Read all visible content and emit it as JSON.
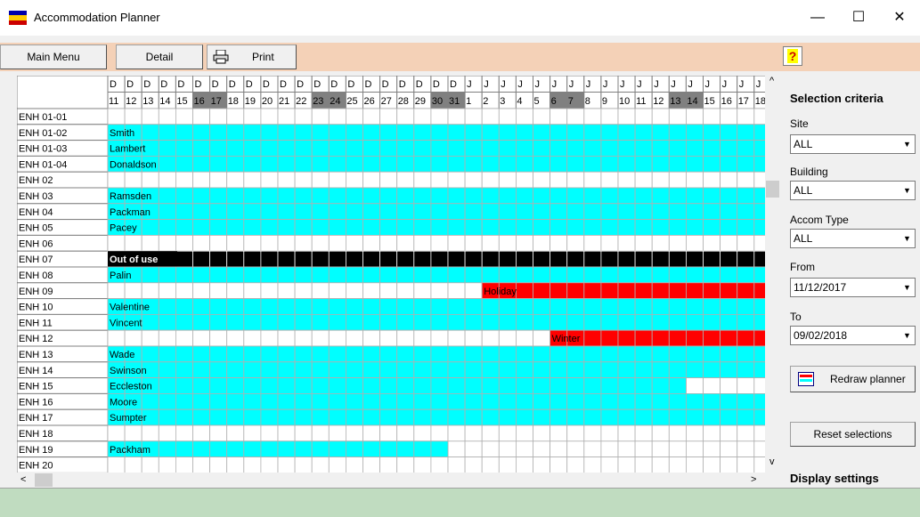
{
  "window": {
    "title": "Accommodation Planner",
    "min_glyph": "—",
    "max_glyph": "☐",
    "close_glyph": "✕"
  },
  "toolbar": {
    "main_menu": "Main Menu",
    "detail": "Detail",
    "print": "Print",
    "print_icon": "printer-icon",
    "help_icon": "help-icon",
    "help_glyph": "?"
  },
  "grid": {
    "date_header": [
      {
        "m": "D",
        "d": "11",
        "w": false
      },
      {
        "m": "D",
        "d": "12",
        "w": false
      },
      {
        "m": "D",
        "d": "13",
        "w": false
      },
      {
        "m": "D",
        "d": "14",
        "w": false
      },
      {
        "m": "D",
        "d": "15",
        "w": false
      },
      {
        "m": "D",
        "d": "16",
        "w": true
      },
      {
        "m": "D",
        "d": "17",
        "w": true
      },
      {
        "m": "D",
        "d": "18",
        "w": false
      },
      {
        "m": "D",
        "d": "19",
        "w": false
      },
      {
        "m": "D",
        "d": "20",
        "w": false
      },
      {
        "m": "D",
        "d": "21",
        "w": false
      },
      {
        "m": "D",
        "d": "22",
        "w": false
      },
      {
        "m": "D",
        "d": "23",
        "w": true
      },
      {
        "m": "D",
        "d": "24",
        "w": true
      },
      {
        "m": "D",
        "d": "25",
        "w": false
      },
      {
        "m": "D",
        "d": "26",
        "w": false
      },
      {
        "m": "D",
        "d": "27",
        "w": false
      },
      {
        "m": "D",
        "d": "28",
        "w": false
      },
      {
        "m": "D",
        "d": "29",
        "w": false
      },
      {
        "m": "D",
        "d": "30",
        "w": true
      },
      {
        "m": "D",
        "d": "31",
        "w": true
      },
      {
        "m": "J",
        "d": "1",
        "w": false
      },
      {
        "m": "J",
        "d": "2",
        "w": false
      },
      {
        "m": "J",
        "d": "3",
        "w": false
      },
      {
        "m": "J",
        "d": "4",
        "w": false
      },
      {
        "m": "J",
        "d": "5",
        "w": false
      },
      {
        "m": "J",
        "d": "6",
        "w": true
      },
      {
        "m": "J",
        "d": "7",
        "w": true
      },
      {
        "m": "J",
        "d": "8",
        "w": false
      },
      {
        "m": "J",
        "d": "9",
        "w": false
      },
      {
        "m": "J",
        "d": "10",
        "w": false
      },
      {
        "m": "J",
        "d": "11",
        "w": false
      },
      {
        "m": "J",
        "d": "12",
        "w": false
      },
      {
        "m": "J",
        "d": "13",
        "w": true
      },
      {
        "m": "J",
        "d": "14",
        "w": true
      },
      {
        "m": "J",
        "d": "15",
        "w": false
      },
      {
        "m": "J",
        "d": "16",
        "w": false
      },
      {
        "m": "J",
        "d": "17",
        "w": false
      },
      {
        "m": "J",
        "d": "18",
        "w": false
      }
    ],
    "rows": [
      {
        "room": "ENH 01-01",
        "bookings": []
      },
      {
        "room": "ENH 01-02",
        "bookings": [
          {
            "label": "Smith",
            "start": 0,
            "end": 39,
            "kind": "guest"
          }
        ]
      },
      {
        "room": "ENH 01-03",
        "bookings": [
          {
            "label": "Lambert",
            "start": 0,
            "end": 39,
            "kind": "guest"
          }
        ]
      },
      {
        "room": "ENH 01-04",
        "bookings": [
          {
            "label": "Donaldson",
            "start": 0,
            "end": 39,
            "kind": "guest"
          }
        ]
      },
      {
        "room": "ENH 02",
        "bookings": []
      },
      {
        "room": "ENH 03",
        "bookings": [
          {
            "label": "Ramsden",
            "start": 0,
            "end": 39,
            "kind": "guest"
          }
        ]
      },
      {
        "room": "ENH 04",
        "bookings": [
          {
            "label": "Packman",
            "start": 0,
            "end": 39,
            "kind": "guest"
          }
        ]
      },
      {
        "room": "ENH 05",
        "bookings": [
          {
            "label": "Pacey",
            "start": 0,
            "end": 39,
            "kind": "guest"
          }
        ]
      },
      {
        "room": "ENH 06",
        "bookings": []
      },
      {
        "room": "ENH 07",
        "bookings": [
          {
            "label": "Out of use",
            "start": 0,
            "end": 39,
            "kind": "closed"
          }
        ]
      },
      {
        "room": "ENH 08",
        "bookings": [
          {
            "label": "Palin",
            "start": 0,
            "end": 39,
            "kind": "guest"
          }
        ]
      },
      {
        "room": "ENH 09",
        "bookings": [
          {
            "label": "Holiday",
            "start": 22,
            "end": 39,
            "kind": "holiday"
          }
        ]
      },
      {
        "room": "ENH 10",
        "bookings": [
          {
            "label": "Valentine",
            "start": 0,
            "end": 39,
            "kind": "guest"
          }
        ]
      },
      {
        "room": "ENH 11",
        "bookings": [
          {
            "label": "Vincent",
            "start": 0,
            "end": 39,
            "kind": "guest"
          }
        ]
      },
      {
        "room": "ENH 12",
        "bookings": [
          {
            "label": "Winter",
            "start": 26,
            "end": 39,
            "kind": "holiday"
          }
        ]
      },
      {
        "room": "ENH 13",
        "bookings": [
          {
            "label": "Wade",
            "start": 0,
            "end": 39,
            "kind": "guest"
          }
        ]
      },
      {
        "room": "ENH 14",
        "bookings": [
          {
            "label": "Swinson",
            "start": 0,
            "end": 39,
            "kind": "guest"
          }
        ]
      },
      {
        "room": "ENH 15",
        "bookings": [
          {
            "label": "Eccleston",
            "start": 0,
            "end": 34,
            "kind": "guest"
          }
        ]
      },
      {
        "room": "ENH 16",
        "bookings": [
          {
            "label": "Moore",
            "start": 0,
            "end": 39,
            "kind": "guest"
          }
        ]
      },
      {
        "room": "ENH 17",
        "bookings": [
          {
            "label": "Sumpter",
            "start": 0,
            "end": 39,
            "kind": "guest"
          }
        ]
      },
      {
        "room": "ENH 18",
        "bookings": []
      },
      {
        "room": "ENH 19",
        "bookings": [
          {
            "label": "Packham",
            "start": 0,
            "end": 20,
            "kind": "guest"
          }
        ]
      },
      {
        "room": "ENH 20",
        "bookings": []
      }
    ]
  },
  "colors": {
    "guest": "#00ffff",
    "closed": "#000000",
    "holiday": "#ff0000",
    "weekend_header": "#808080",
    "toolbar_bg": "#f4d1b7",
    "status_bg": "#c0dcc0"
  },
  "panel": {
    "heading": "Selection criteria",
    "site_label": "Site",
    "site_value": "ALL",
    "building_label": "Building",
    "building_value": "ALL",
    "accom_label": "Accom Type",
    "accom_value": "ALL",
    "from_label": "From",
    "from_value": "11/12/2017",
    "to_label": "To",
    "to_value": "09/02/2018",
    "redraw": "Redraw planner",
    "reset": "Reset selections",
    "display_heading": "Display settings"
  },
  "scroll": {
    "up": "^",
    "down": "v",
    "left": "<",
    "right": ">"
  }
}
